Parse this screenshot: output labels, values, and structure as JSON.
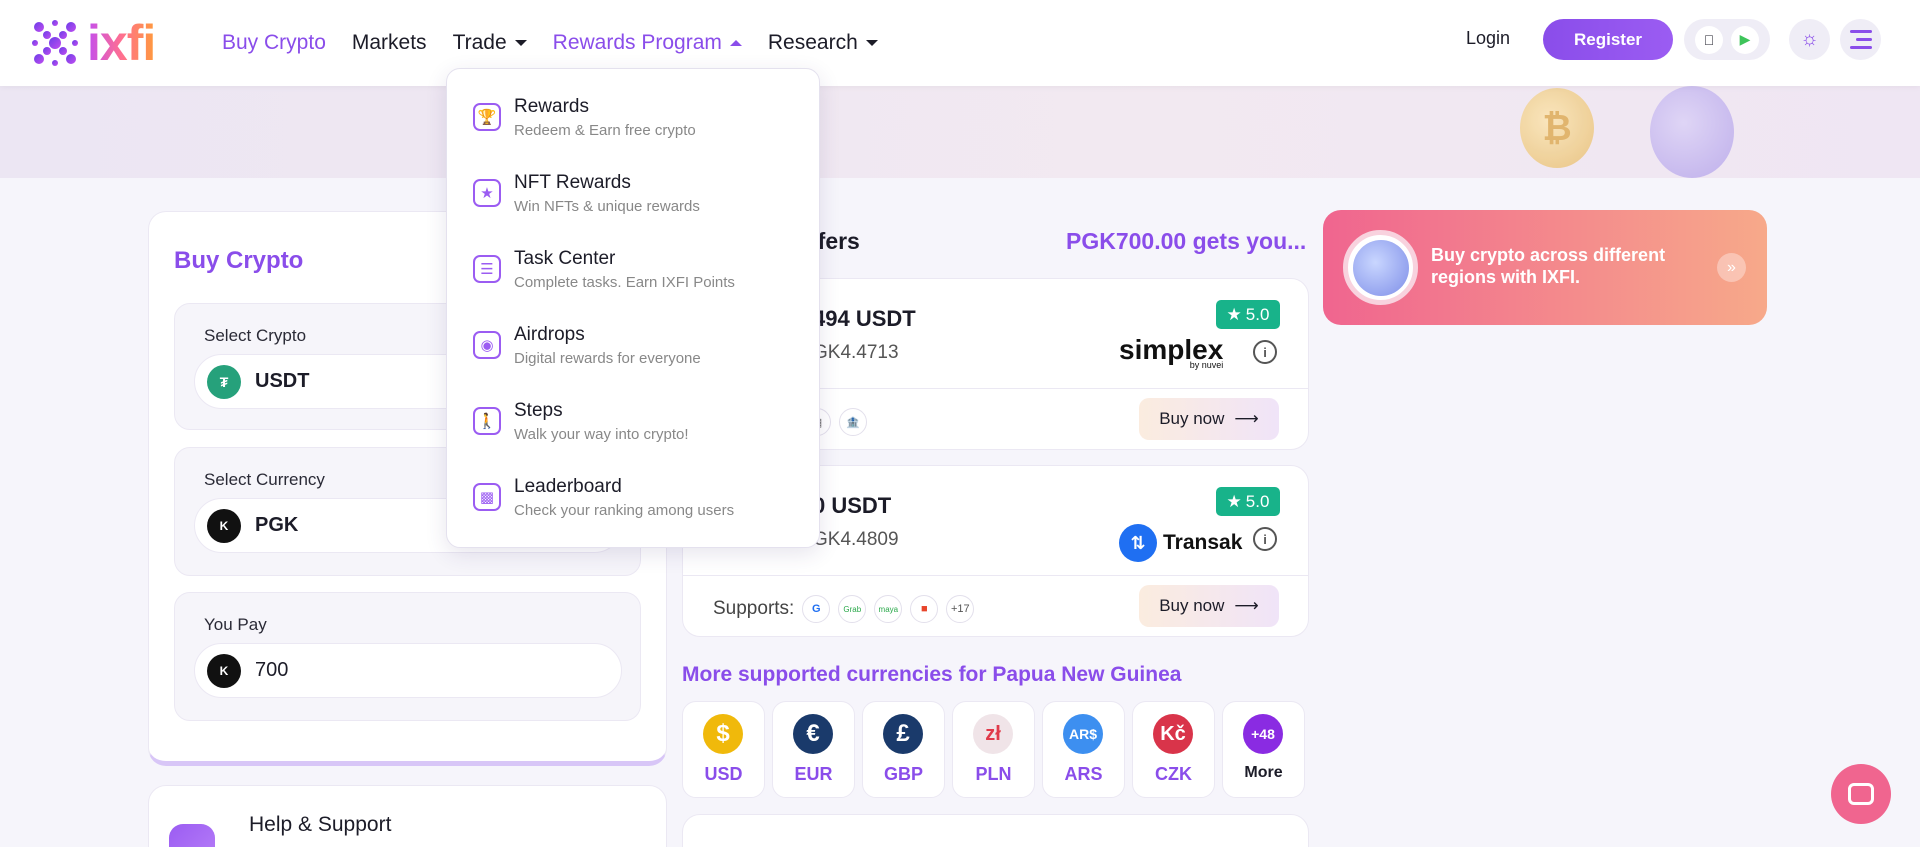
{
  "header": {
    "logo_text": "ixfi",
    "nav": {
      "buy_crypto": "Buy Crypto",
      "markets": "Markets",
      "trade": "Trade",
      "rewards_program": "Rewards Program",
      "research": "Research"
    },
    "login": "Login",
    "register": "Register"
  },
  "dropdown": {
    "items": [
      {
        "title": "Rewards",
        "subtitle": "Redeem & Earn free crypto",
        "icon": "trophy-icon"
      },
      {
        "title": "NFT Rewards",
        "subtitle": "Win NFTs & unique rewards",
        "icon": "nft-trophy-icon"
      },
      {
        "title": "Task Center",
        "subtitle": "Complete tasks. Earn IXFI Points",
        "icon": "task-list-icon"
      },
      {
        "title": "Airdrops",
        "subtitle": "Digital rewards for everyone",
        "icon": "airdrop-icon"
      },
      {
        "title": "Steps",
        "subtitle": "Walk your way into crypto!",
        "icon": "walking-icon"
      },
      {
        "title": "Leaderboard",
        "subtitle": "Check your ranking among users",
        "icon": "leaderboard-icon"
      }
    ]
  },
  "buy_panel": {
    "title": "Buy Crypto",
    "select_crypto_label": "Select Crypto",
    "crypto_value": "USDT",
    "select_currency_label": "Select Currency",
    "currency_value": "PGK",
    "currency_symbol": "K",
    "you_pay_label": "You Pay",
    "you_pay_value": "700"
  },
  "help": {
    "label": "Help & Support"
  },
  "offers": {
    "title_fragment": "ffers",
    "amount_text": "PGK700.00 gets you...",
    "cards": [
      {
        "amount": "494 USDT",
        "rate": "GK4.4713",
        "rating": "5.0",
        "provider": "simplex",
        "provider_sub": "by nuvei",
        "buy_now": "Buy now"
      },
      {
        "amount": "0 USDT",
        "rate": "GK4.4809",
        "rating": "5.0",
        "provider": "Transak",
        "supports_label": "Supports:",
        "supports_more": "+17",
        "buy_now": "Buy now"
      }
    ]
  },
  "more_currencies": {
    "title": "More supported currencies for Papua New Guinea",
    "items": [
      {
        "code": "USD",
        "symbol": "$",
        "color": "#f0b90b"
      },
      {
        "code": "EUR",
        "symbol": "€",
        "color": "#1a3a6b"
      },
      {
        "code": "GBP",
        "symbol": "£",
        "color": "#1a3a6b"
      },
      {
        "code": "PLN",
        "symbol": "zł",
        "color": "#f0e4e8"
      },
      {
        "code": "ARS",
        "symbol": "AR$",
        "color": "#3d8ff0"
      },
      {
        "code": "CZK",
        "symbol": "Kč",
        "color": "#d9344a"
      },
      {
        "code": "More",
        "symbol": "+48",
        "color": "#8a2be2"
      }
    ]
  },
  "promo": {
    "text": "Buy crypto across different regions with IXFI."
  }
}
